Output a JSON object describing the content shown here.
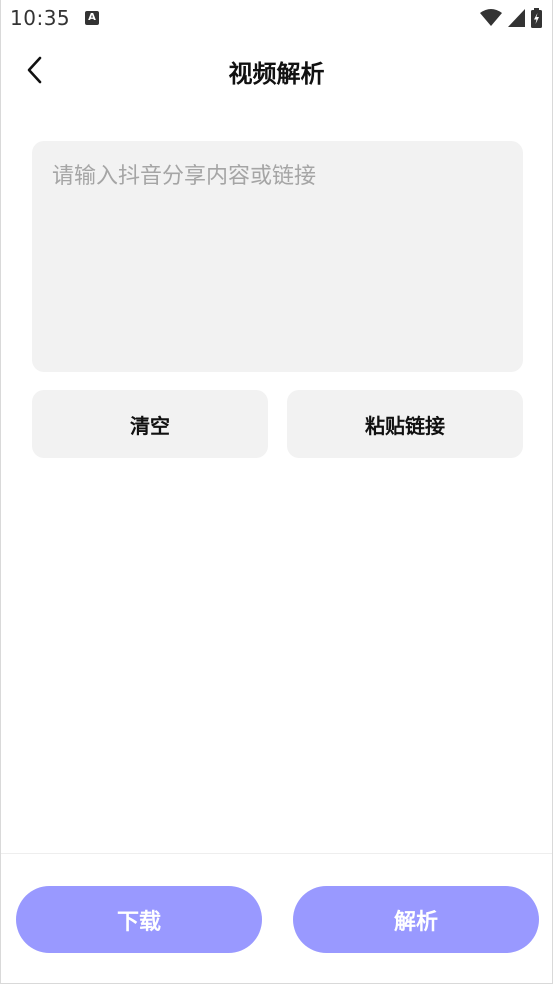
{
  "status_bar": {
    "time": "10:35",
    "notification_glyph": "A",
    "icons": [
      "wifi-icon",
      "signal-icon",
      "battery-icon"
    ]
  },
  "app_bar": {
    "back_icon": "chevron-left-icon",
    "title": "视频解析"
  },
  "input": {
    "placeholder": "请输入抖音分享内容或链接",
    "value": ""
  },
  "actions": {
    "clear_label": "清空",
    "paste_label": "粘贴链接"
  },
  "bottom_bar": {
    "download_label": "下载",
    "parse_label": "解析"
  },
  "colors": {
    "primary": "#9999ff",
    "surface": "#f2f2f2",
    "placeholder": "#a5a5a5"
  }
}
